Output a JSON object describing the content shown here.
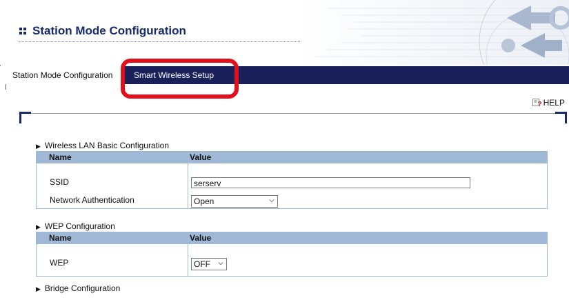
{
  "header": {
    "title": "Station Mode Configuration"
  },
  "tabs": [
    {
      "label": "Station Mode Configuration"
    },
    {
      "label": "Smart Wireless Setup"
    }
  ],
  "help": {
    "label": "HELP"
  },
  "sections": {
    "wireless": {
      "title": "Wireless LAN Basic Configuration",
      "col_name": "Name",
      "col_value": "Value",
      "ssid_label": "SSID",
      "ssid_value": "serserv",
      "auth_label": "Network Authentication",
      "auth_value": "Open"
    },
    "wep": {
      "title": "WEP Configuration",
      "col_name": "Name",
      "col_value": "Value",
      "wep_label": "WEP",
      "wep_value": "OFF"
    },
    "bridge": {
      "title": "Bridge Configuration"
    }
  },
  "colors": {
    "tab_bar": "#19205a",
    "table_header": "#9fb8d5",
    "highlight": "#e0101c",
    "title": "#152a6b"
  }
}
